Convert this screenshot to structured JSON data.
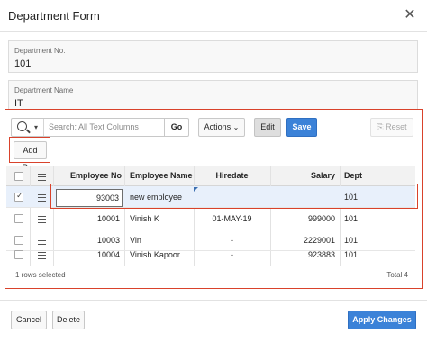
{
  "dialog": {
    "title": "Department Form",
    "close_icon": "close-icon"
  },
  "fields": {
    "dept_no": {
      "label": "Department No.",
      "value": "101"
    },
    "dept_name": {
      "label": "Department Name",
      "value": "IT"
    }
  },
  "toolbar": {
    "search_placeholder": "Search: All Text Columns",
    "go_label": "Go",
    "actions_label": "Actions",
    "edit_label": "Edit",
    "save_label": "Save",
    "reset_label": "Reset",
    "add_row_label": "Add Row"
  },
  "grid": {
    "headers": {
      "emp_no": "Employee No",
      "emp_name": "Employee Name",
      "hiredate": "Hiredate",
      "salary": "Salary",
      "dept": "Dept"
    },
    "rows": [
      {
        "emp_no": "93003",
        "emp_name": "new employee",
        "hiredate": "",
        "salary": "",
        "dept": "101",
        "checked": true
      },
      {
        "emp_no": "10001",
        "emp_name": "Vinish K",
        "hiredate": "01-MAY-19",
        "salary": "999000",
        "dept": "101",
        "checked": false
      },
      {
        "emp_no": "10003",
        "emp_name": "Vin",
        "hiredate": "-",
        "salary": "2229001",
        "dept": "101",
        "checked": false
      },
      {
        "emp_no": "10004",
        "emp_name": "Vinish Kapoor",
        "hiredate": "-",
        "salary": "923883",
        "dept": "101",
        "checked": false
      }
    ],
    "footer": {
      "selected": "1 rows selected",
      "total": "Total 4"
    }
  },
  "bottom": {
    "cancel_label": "Cancel",
    "delete_label": "Delete",
    "apply_label": "Apply Changes"
  },
  "colors": {
    "accent": "#3b82d8",
    "highlight": "#d9422b",
    "selected_row": "#e8f0fb"
  }
}
